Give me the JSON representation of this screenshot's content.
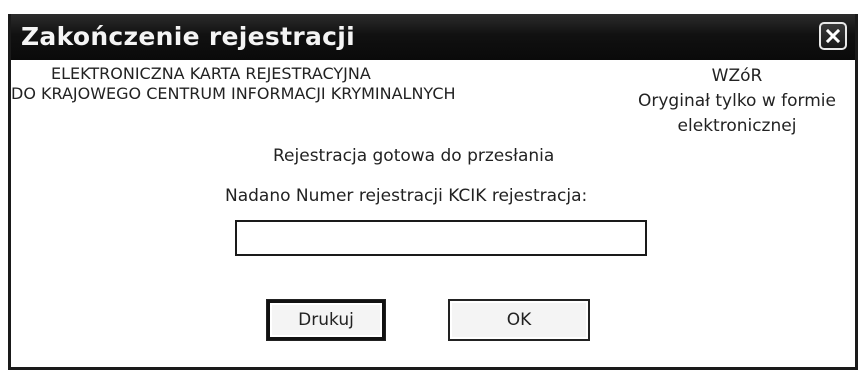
{
  "window": {
    "title": "Zakończenie rejestracji",
    "close_icon": "close-icon"
  },
  "header": {
    "left_line1": "ELEKTRONICZNA KARTA REJESTRACYJNA",
    "left_line2": "DO KRAJOWEGO CENTRUM INFORMACJI KRYMINALNYCH",
    "right_line1": "WZóR",
    "right_line2": "Oryginał tylko w formie",
    "right_line3": "elektronicznej"
  },
  "body": {
    "status": "Rejestracja gotowa do przesłania",
    "assigned_label": "Nadano Numer rejestracji KCIK rejestracja:",
    "registration_number": ""
  },
  "buttons": {
    "print_label": "Drukuj",
    "ok_label": "OK"
  },
  "colors": {
    "titlebar": "#111111",
    "title_text": "#f4f4f4",
    "background": "#ffffff"
  }
}
